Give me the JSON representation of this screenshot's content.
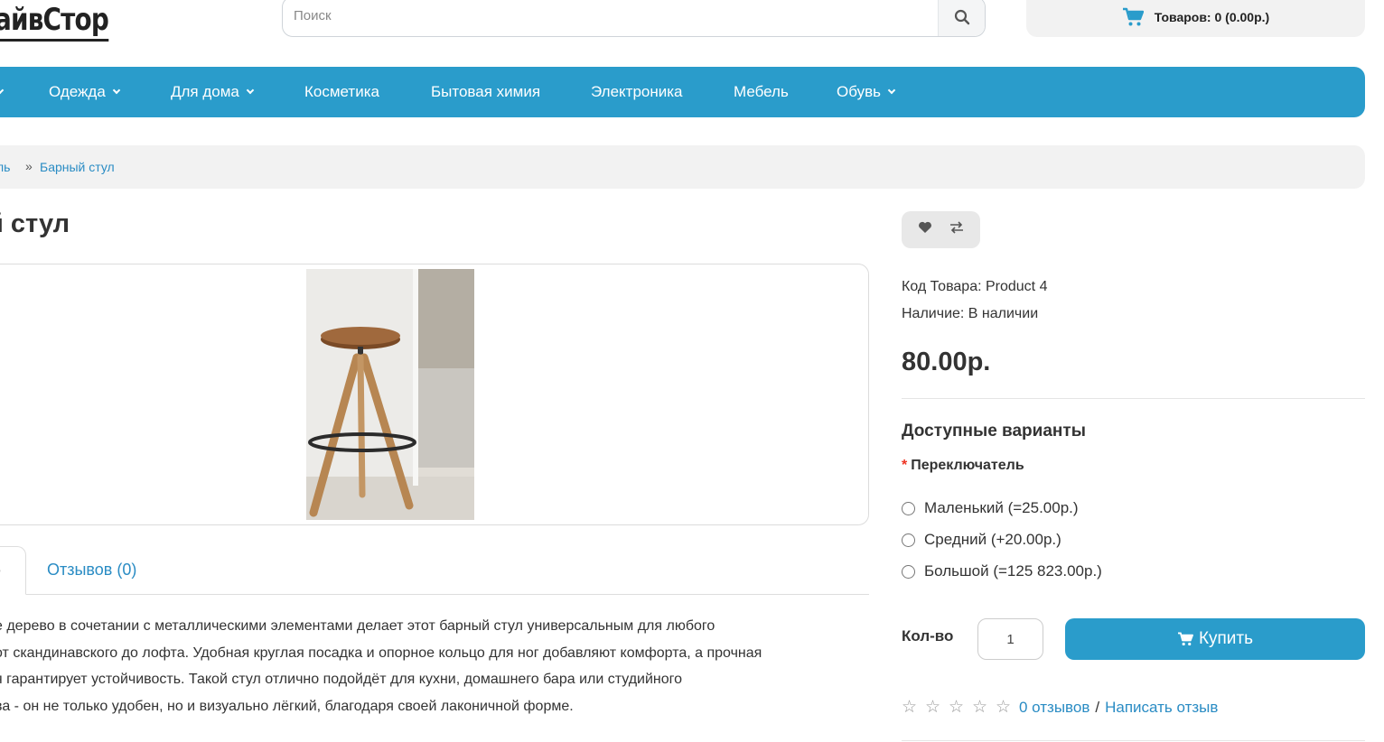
{
  "header": {
    "logo_text": "айвСтор",
    "search_placeholder": "Поиск",
    "cart_label": "Товаров: 0 (0.00р.)"
  },
  "nav": {
    "items": [
      {
        "label": "Одежда",
        "dropdown": true
      },
      {
        "label": "Для дома",
        "dropdown": true
      },
      {
        "label": "Косметика",
        "dropdown": false
      },
      {
        "label": "Бытовая химия",
        "dropdown": false
      },
      {
        "label": "Электроника",
        "dropdown": false
      },
      {
        "label": "Мебель",
        "dropdown": false
      },
      {
        "label": "Обувь",
        "dropdown": true
      }
    ]
  },
  "breadcrumb": {
    "items": [
      "ль",
      "Барный стул"
    ],
    "separator": "»"
  },
  "product": {
    "title": "й стул",
    "code_label": "Код Товара:",
    "code_value": "Product 4",
    "stock_label": "Наличие:",
    "stock_value": "В наличии",
    "price": "80.00р."
  },
  "tabs": {
    "active_label": "е",
    "reviews_label": "Отзывов (0)"
  },
  "description": {
    "lines": [
      "е дерево в сочетании с металлическими элементами делает этот барный стул универсальным для любого",
      "от скандинавского до лофта. Удобная круглая посадка и опорное кольцо для ног добавляют комфорта, а прочная",
      "я гарантирует устойчивость. Такой стул отлично подойдёт для кухни, домашнего бара или студийного",
      "ва - он не только удобен, но и визуально лёгкий, благодаря своей лаконичной форме."
    ]
  },
  "options": {
    "heading": "Доступные варианты",
    "required_mark": "*",
    "group_label": "Переключатель",
    "choices": [
      "Маленький (=25.00р.)",
      "Средний (+20.00р.)",
      "Большой (=125 823.00р.)"
    ]
  },
  "purchase": {
    "qty_label": "Кол-во",
    "qty_value": "1",
    "buy_label": "Купить"
  },
  "reviews": {
    "stars_filled": 0,
    "stars_total": 5,
    "count_link": "0 отзывов",
    "separator": "/",
    "write_link": "Написать отзыв"
  },
  "colors": {
    "accent": "#2a9ccb",
    "link": "#2a8cc4",
    "required": "#ee3322"
  },
  "icons": [
    "search-icon",
    "cart-icon",
    "chevron-down-icon",
    "heart-icon",
    "compare-icon",
    "cart-icon",
    "star-icon"
  ]
}
